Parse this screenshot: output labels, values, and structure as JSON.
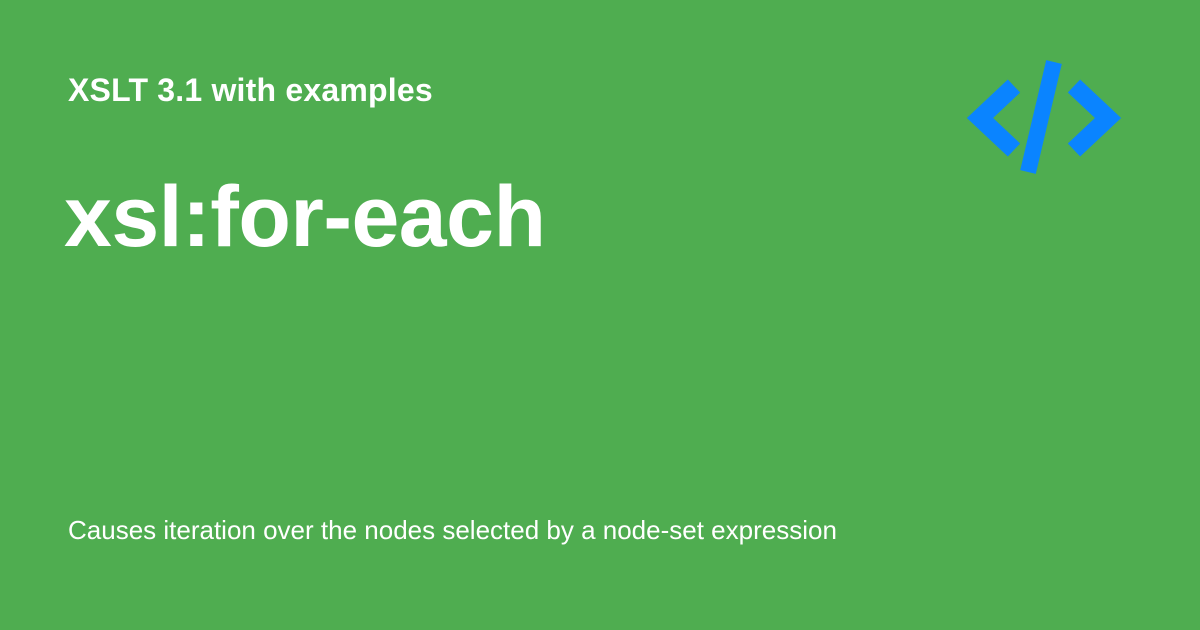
{
  "card": {
    "kicker": "XSLT 3.1 with examples",
    "title": "xsl:for-each",
    "description": "Causes iteration over the nodes selected by a node-set expression",
    "background_color": "#4fad50",
    "text_color": "#ffffff",
    "logo": {
      "icon": "code-brackets-icon",
      "color": "#0a84ff"
    }
  }
}
